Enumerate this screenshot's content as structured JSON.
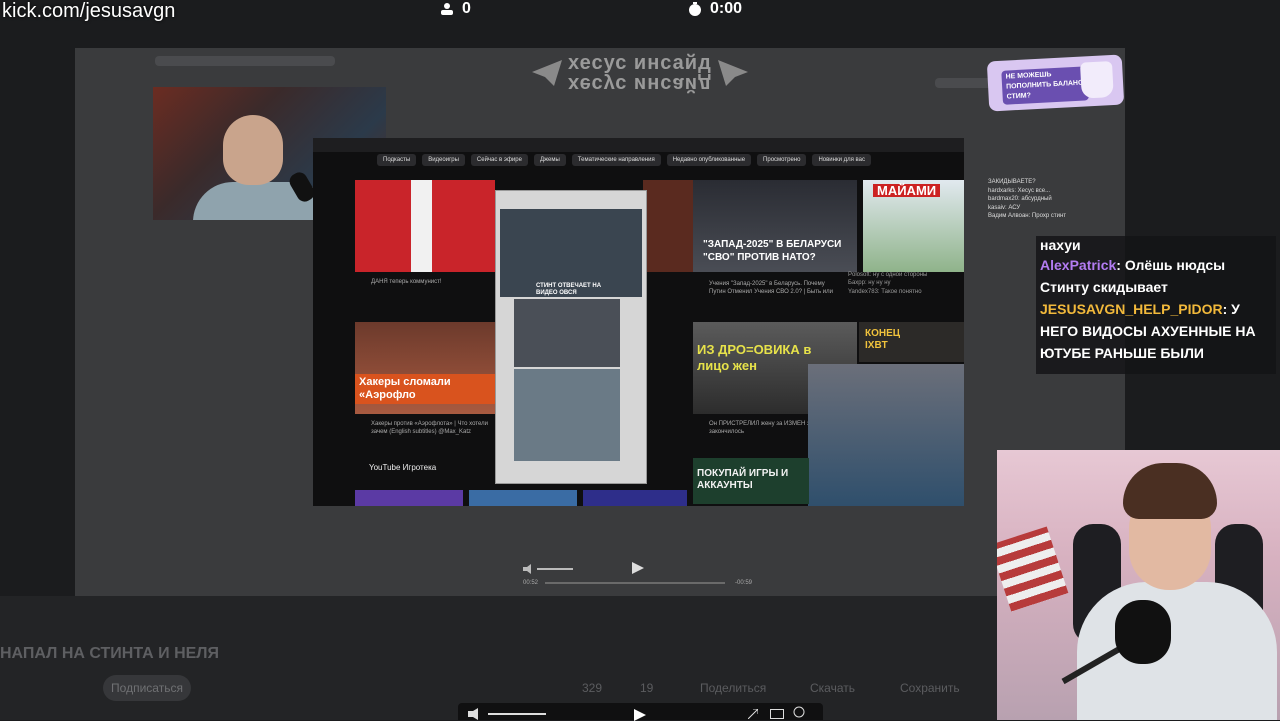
{
  "overlay": {
    "url": "kick.com/jesusavgn",
    "viewers": "0",
    "timer": "0:00",
    "viewer_icon": "viewers-icon",
    "timer_icon": "stopwatch-icon"
  },
  "header": {
    "logo_text": "хесус инсайд",
    "logo_text_mirrored": "хесус инсайд",
    "sticker_text": "НЕ МОЖЕШЬ ПОПОЛНИТЬ БАЛАНС СТИМ?"
  },
  "shared_screen": {
    "nav_chips": [
      "Подкасты",
      "Видеоигры",
      "Сейчас в эфире",
      "Джемы",
      "Тематические направления",
      "Недавно опубликованные",
      "Просмотрено",
      "Новинки для вас"
    ],
    "captions": {
      "putin": "\"ЗАПАД-2025\" В БЕЛАРУСИ \"СВО\" ПРОТИВ НАТО?",
      "miami": "МАЙАМИ",
      "hackers": "Хакеры сломали «Аэрофло",
      "popup_label": "СТИНТ ОТВЕЧАЕТ НА ВИДЕО ОВСЯ",
      "drone": "ИЗ ДРО=ОВИКА в лицо жен",
      "konec": "КОНЕЦ IXBT",
      "games": "ПОКУПАЙ ИГРЫ И АККАУНТЫ",
      "yt_games": "YouTube Игротека"
    },
    "meta": {
      "danya": "ДАНЯ теперь коммунист!",
      "putin_desc": "Учения \"Запад-2025\" в Беларусь. Почему Путин Отменил Учения СВО 2.0? | Быть или",
      "hackers_desc": "Хакеры против «Аэрофлота» | Что хотели зачем (English subtitles) @Max_Katz",
      "drone_desc": "Он ПРИСТРЕЛИЛ жену за ИЗМЕН это закончилось"
    }
  },
  "chat_background": [
    "ЗАКИДЫВАЕТЕ?",
    "hardxarks: Хесус все...",
    "bardmax20: абсурдный",
    "kasaiv: АСУ",
    "Вадим Алвоан: Прохр стинт",
    "Polosoft: ну с одной стороны",
    "Бахрр: ну ну ну",
    "Yandex783: Такое понятно"
  ],
  "chat": {
    "messages": [
      {
        "user": "",
        "user_color": "#ffffff",
        "text": "нахуи"
      },
      {
        "user": "AlexPatrick",
        "user_color": "#b37cf2",
        "text": ": Олёшь нюдсы Стинту скидывает"
      },
      {
        "user": "JESUSAVGN_HELP_PIDOR",
        "user_color": "#f2b93b",
        "text": ": У НЕГО ВИДОСЫ АХУЕННЫЕ НА ЮТУБЕ РАНЬШЕ БЫЛИ"
      }
    ]
  },
  "background_page": {
    "title": "НАПАЛ НА СТИНТА И НЕЛЯ",
    "subscribe": "Подписаться",
    "likes": "329",
    "dislikes": "19",
    "share": "Поделиться",
    "download": "Скачать",
    "save": "Сохранить",
    "small_player_time_left": "00:52",
    "small_player_time_right": "-00:59"
  },
  "colors": {
    "background": "#1b1c1e",
    "kick_green": "#53fc18",
    "username_purple": "#b37cf2",
    "username_gold": "#f2b93b"
  }
}
